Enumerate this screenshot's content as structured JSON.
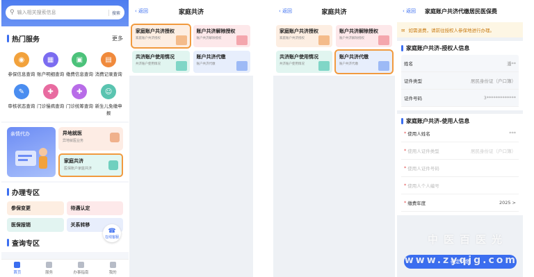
{
  "panel1": {
    "search_placeholder": "输入相关搜索信息",
    "search_button": "搜索",
    "hot_services_title": "热门服务",
    "more_label": "更多",
    "services": [
      {
        "label": "参保信息查询",
        "color": "#f2a23c",
        "icon": "shield-icon"
      },
      {
        "label": "账户明细查询",
        "color": "#7b6cf0",
        "icon": "ledger-icon"
      },
      {
        "label": "缴费信息查询",
        "color": "#4cc27a",
        "icon": "payment-icon"
      },
      {
        "label": "消费记录查询",
        "color": "#f08a3c",
        "icon": "receipt-icon"
      },
      {
        "label": "审核状态查询",
        "color": "#4a8df0",
        "icon": "audit-icon"
      },
      {
        "label": "门诊慢病查询",
        "color": "#e86ba0",
        "icon": "clinic-icon"
      },
      {
        "label": "门诊统筹查询",
        "color": "#b86ce8",
        "icon": "hospital-icon"
      },
      {
        "label": "新生儿免缴申报",
        "color": "#5ac4b0",
        "icon": "baby-icon"
      }
    ],
    "promo_left_label": "亲情代办",
    "promo_yd_title": "异地就医",
    "promo_yd_sub": "异地就医业务",
    "promo_jt_title": "家庭共济",
    "promo_jt_sub": "医保账户家庭共济",
    "zone_title": "办理专区",
    "zone_items": [
      "参保变更",
      "待遇认定",
      "医保报销",
      "关系转移"
    ],
    "query_zone_title": "查询专区",
    "float_label": "在线客服",
    "tabs": [
      "首页",
      "服务",
      "办事指南",
      "我的"
    ]
  },
  "panel2": {
    "back_label": "返回",
    "title": "家庭共济",
    "cards": [
      {
        "title": "家庭账户共济授权",
        "sub": "家庭账户共济授权"
      },
      {
        "title": "账户共济解除授权",
        "sub": "账户共济解除授权"
      },
      {
        "title": "共济账户使用情况",
        "sub": "共济账户使用情况"
      },
      {
        "title": "账户共济代缴",
        "sub": "账户共济代缴"
      }
    ]
  },
  "panel3": {
    "back_label": "返回",
    "title": "家庭共济",
    "cards": [
      {
        "title": "家庭账户共济授权",
        "sub": "家庭账户共济授权"
      },
      {
        "title": "账户共济解除授权",
        "sub": "账户共济解除授权"
      },
      {
        "title": "共济账户使用情况",
        "sub": "共济账户使用情况"
      },
      {
        "title": "账户共济代缴",
        "sub": "账户共济代缴"
      }
    ]
  },
  "panel4": {
    "back_label": "返回",
    "title": "家庭账户共济代缴居民医保费",
    "notice": "如需退费，请前往授权人参保地进行办理。",
    "auth_section": "家庭账户共济-授权人信息",
    "auth_rows": [
      {
        "k": "姓名",
        "v": "潘**"
      },
      {
        "k": "证件类型",
        "v": "居民身份证（户口簿）"
      },
      {
        "k": "证件号码",
        "v": "3*************"
      }
    ],
    "user_section": "家庭账户共济-使用人信息",
    "user_rows": [
      {
        "k": "使用人姓名",
        "v": "***"
      },
      {
        "k": "使用人证件类型",
        "v": "居民身份证（户口簿）"
      },
      {
        "k": "使用人证件号码",
        "v": ""
      },
      {
        "k": "使用人个人编号",
        "v": ""
      },
      {
        "k": "缴费年度",
        "v": "2025 >"
      }
    ],
    "submit_label": "确定代缴",
    "watermark_cn": "中医百医光",
    "watermark_en": "www.zyqjg.com"
  },
  "colors": {
    "accent": "#3b6ef0",
    "highlight": "#f19a3e",
    "notice": "#c97b12"
  }
}
